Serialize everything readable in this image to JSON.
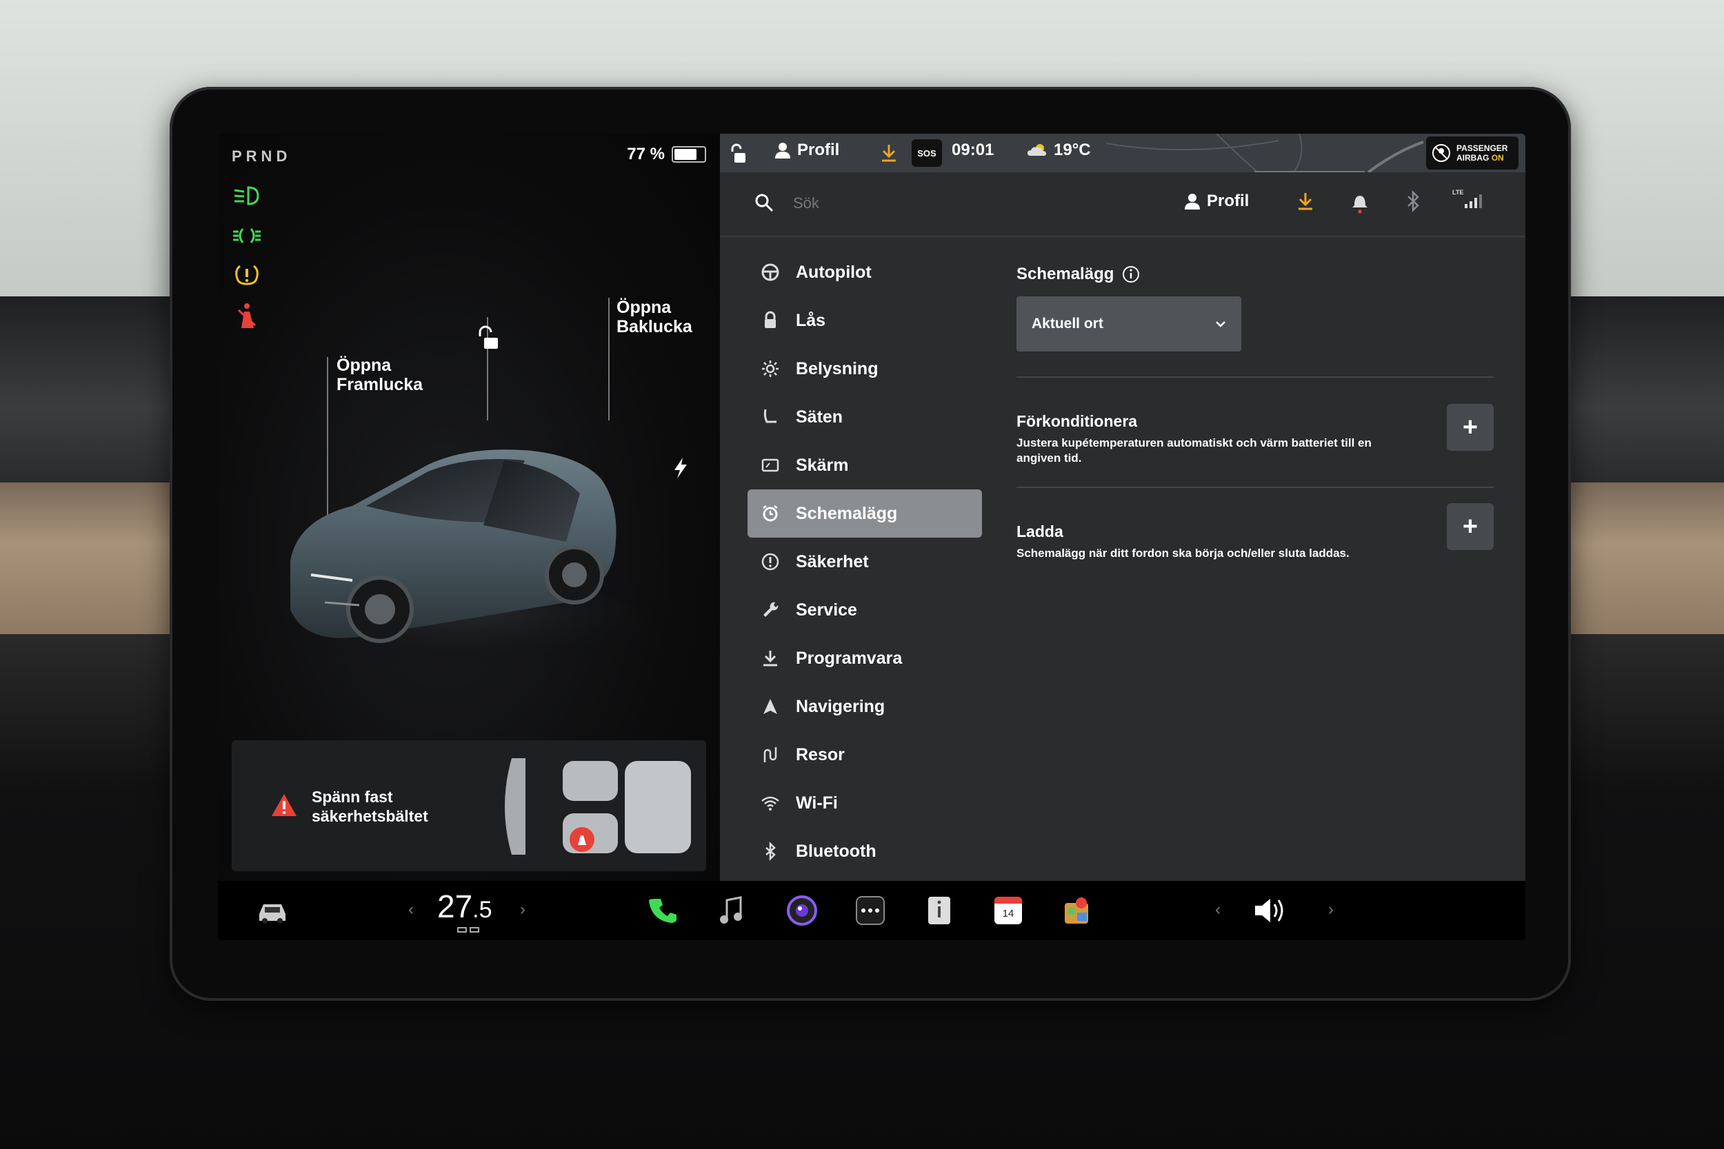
{
  "left_panel": {
    "gear": "PRND",
    "battery_percent": "77 %",
    "battery_level": 0.77,
    "callouts": {
      "frunk_line1": "Öppna",
      "frunk_line2": "Framlucka",
      "trunk_line1": "Öppna",
      "trunk_line2": "Baklucka"
    },
    "alert": {
      "line1": "Spänn fast",
      "line2": "säkerhetsbältet"
    },
    "colors": {
      "green": "#3ddc53",
      "yellow": "#f2c31b",
      "red": "#e8413a"
    }
  },
  "status_bar": {
    "profile": "Profil",
    "sos": "SOS",
    "time": "09:01",
    "temperature": "19°C",
    "airbag_line1": "PASSENGER",
    "airbag_line2": "AIRBAG",
    "airbag_state": "ON"
  },
  "search": {
    "placeholder": "Sök",
    "profile": "Profil",
    "lte": "LTE"
  },
  "menu": {
    "items": [
      {
        "label": "Autopilot",
        "icon": "steering-wheel-icon"
      },
      {
        "label": "Lås",
        "icon": "lock-icon"
      },
      {
        "label": "Belysning",
        "icon": "sun-icon"
      },
      {
        "label": "Säten",
        "icon": "seat-icon"
      },
      {
        "label": "Skärm",
        "icon": "display-icon"
      },
      {
        "label": "Schemalägg",
        "icon": "alarm-clock-icon"
      },
      {
        "label": "Säkerhet",
        "icon": "info-circle-icon"
      },
      {
        "label": "Service",
        "icon": "wrench-icon"
      },
      {
        "label": "Programvara",
        "icon": "download-icon"
      },
      {
        "label": "Navigering",
        "icon": "navigation-arrow-icon"
      },
      {
        "label": "Resor",
        "icon": "trips-icon"
      },
      {
        "label": "Wi-Fi",
        "icon": "wifi-icon"
      },
      {
        "label": "Bluetooth",
        "icon": "bluetooth-icon"
      }
    ],
    "active": "Schemalägg"
  },
  "schedule": {
    "heading": "Schemalägg",
    "location_select": "Aktuell ort",
    "precondition": {
      "title": "Förkonditionera",
      "description": "Justera kupétemperaturen automatiskt och värm batteriet till en angiven tid."
    },
    "charge": {
      "title": "Ladda",
      "description": "Schemalägg när ditt fordon ska börja och/eller sluta laddas."
    },
    "add_label": "+"
  },
  "dock": {
    "temp_whole": "27",
    "temp_decimal": ".5",
    "calendar_day": "14"
  }
}
